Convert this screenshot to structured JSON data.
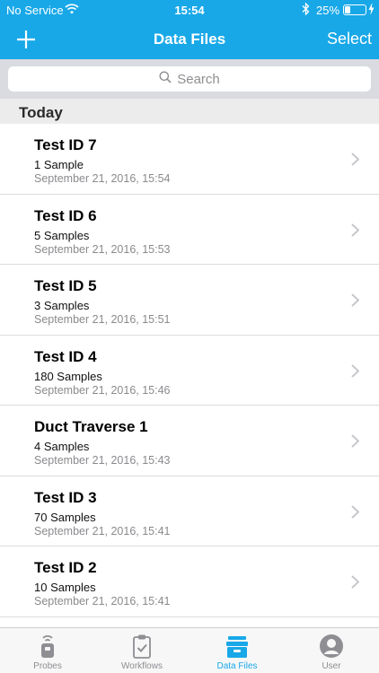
{
  "status_bar": {
    "carrier": "No Service",
    "time": "15:54",
    "battery_text": "25%",
    "battery_level": 0.25
  },
  "nav": {
    "title": "Data Files",
    "select_label": "Select",
    "add_icon": "plus-icon"
  },
  "search": {
    "placeholder": "Search",
    "icon": "search-icon"
  },
  "section": {
    "label": "Today"
  },
  "files": [
    {
      "name": "Test ID 7",
      "samples": "1 Sample",
      "date": "September 21, 2016, 15:54"
    },
    {
      "name": "Test ID 6",
      "samples": "5 Samples",
      "date": "September 21, 2016, 15:53"
    },
    {
      "name": "Test ID 5",
      "samples": "3 Samples",
      "date": "September 21, 2016, 15:51"
    },
    {
      "name": "Test ID 4",
      "samples": "180 Samples",
      "date": "September 21, 2016, 15:46"
    },
    {
      "name": "Duct Traverse 1",
      "samples": "4 Samples",
      "date": "September 21, 2016, 15:43"
    },
    {
      "name": "Test ID 3",
      "samples": "70 Samples",
      "date": "September 21, 2016, 15:41"
    },
    {
      "name": "Test ID 2",
      "samples": "10 Samples",
      "date": "September 21, 2016, 15:41"
    }
  ],
  "tabbar": {
    "tabs": [
      {
        "label": "Probes",
        "icon": "probe-icon"
      },
      {
        "label": "Workflows",
        "icon": "clipboard-check-icon"
      },
      {
        "label": "Data Files",
        "icon": "file-box-icon",
        "active": true
      },
      {
        "label": "User",
        "icon": "user-icon"
      }
    ]
  },
  "colors": {
    "accent": "#18a8e8",
    "inactive": "#8e8e93"
  }
}
